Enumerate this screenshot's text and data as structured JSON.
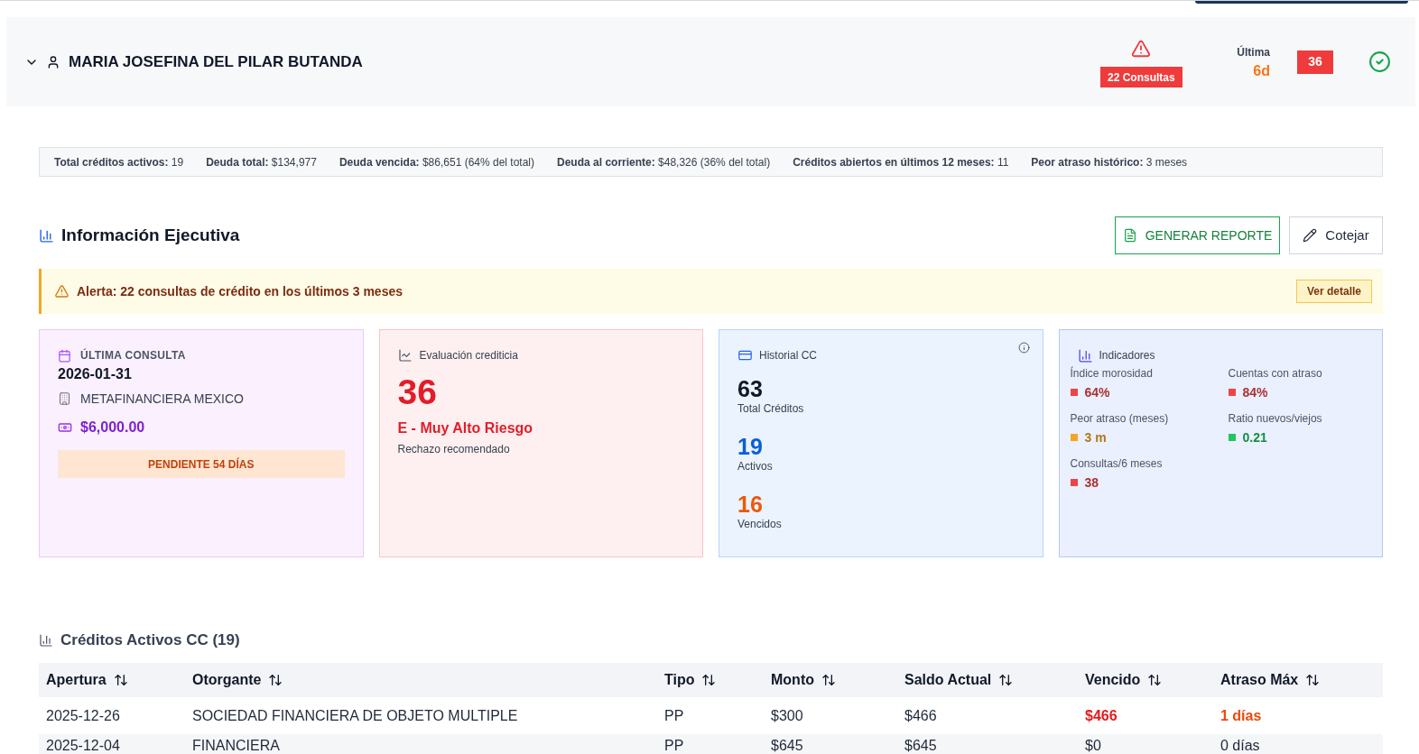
{
  "client": {
    "name": "MARIA JOSEFINA DEL PILAR BUTANDA",
    "expanded": true,
    "consultas_badge": "22 Consultas",
    "ultima_label": "Última",
    "ultima_value": "6d",
    "score_badge": "36",
    "verified": true
  },
  "summary": [
    "**Total créditos activos:** 19",
    "**Deuda total:** $134,977",
    "**Deuda vencida:** $86,651 (64% del total)",
    "**Deuda al corriente:** $48,326 (36% del total)",
    "**Créditos abiertos en últimos 12 meses:** 11",
    "**Peor atraso histórico:** 3 meses"
  ],
  "executive": {
    "title": "Información Ejecutiva",
    "buttons": [
      {
        "label": "GENERAR REPORTE",
        "kind": "pdf"
      },
      {
        "label": "Cotejar",
        "kind": "edit"
      }
    ]
  },
  "alert": {
    "text": "Alerta: 22 consultas de crédito en los últimos 3 meses",
    "action": "Ver detalle"
  },
  "cards": [
    {
      "kind": "last_query",
      "title": "ÚLTIMA CONSULTA",
      "date": "2026-01-31",
      "institution": "METAFINANCIERA MEXICO",
      "amount": "$6,000.00",
      "status": "PENDIENTE 54 DÍAS"
    },
    {
      "kind": "evaluation",
      "title": "Evaluación crediticia",
      "score": "36",
      "rating": "E - Muy Alto Riesgo",
      "recommendation": "Rechazo recomendado"
    },
    {
      "kind": "history",
      "title": "Historial CC",
      "stats": [
        {
          "value": "63",
          "label": "Total Créditos",
          "color": "#111827"
        },
        {
          "value": "19",
          "label": "Activos",
          "color": "#0b5ed7"
        },
        {
          "value": "16",
          "label": "Vencidos",
          "color": "#ea580c"
        }
      ]
    },
    {
      "kind": "indicators",
      "title": "Indicadores",
      "items": [
        {
          "label": "Índice morosidad",
          "value": "64%",
          "color": "#ef4444"
        },
        {
          "label": "Cuentas con atraso",
          "value": "84%",
          "color": "#ef4444"
        },
        {
          "label": "Peor atraso (meses)",
          "value": "3 m",
          "color": "#f5a524"
        },
        {
          "label": "Ratio nuevos/viejos",
          "value": "0.21",
          "color": "#22c55e"
        },
        {
          "label": "Consultas/6 meses",
          "value": "38",
          "color": "#ef4444"
        }
      ]
    }
  ],
  "table": {
    "title": "Créditos Activos CC (19)",
    "columns": [
      "Apertura",
      "Otorgante",
      "Tipo",
      "Monto",
      "Saldo Actual",
      "Vencido",
      "Atraso Máx"
    ],
    "rows": [
      {
        "cells": [
          "2025-12-26",
          "SOCIEDAD FINANCIERA DE OBJETO MULTIPLE",
          "PP",
          "$300",
          "$466",
          "$466",
          "1 días"
        ],
        "overdue": true
      },
      {
        "cells": [
          "2025-12-04",
          "FINANCIERA",
          "PP",
          "$645",
          "$645",
          "$0",
          "0 días"
        ],
        "overdue": false
      }
    ]
  }
}
